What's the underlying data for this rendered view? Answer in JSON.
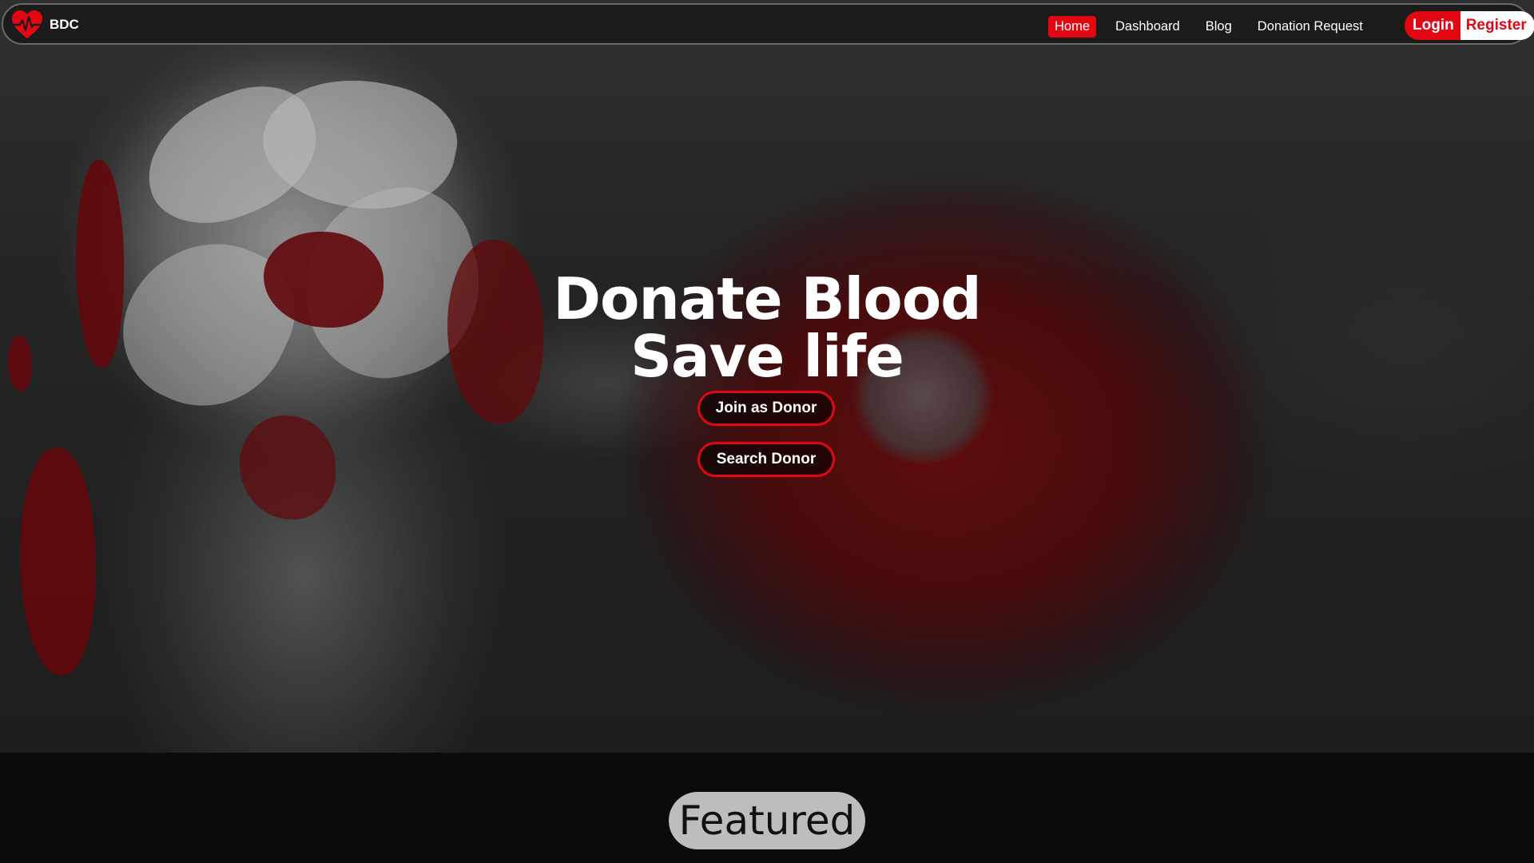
{
  "brand": {
    "name": "BDC",
    "logo_icon": "heart-pulse-icon",
    "accent": "#e30613"
  },
  "nav": {
    "links": [
      {
        "label": "Home",
        "active": true
      },
      {
        "label": "Dashboard",
        "active": false
      },
      {
        "label": "Blog",
        "active": false
      },
      {
        "label": "Donation Request",
        "active": false
      }
    ],
    "login_label": "Login",
    "register_label": "Register"
  },
  "hero": {
    "title_line1": "Donate Blood",
    "title_line2": "Save life",
    "join_label": "Join as Donor",
    "search_label": "Search Donor"
  },
  "featured": {
    "title": "Featured"
  }
}
